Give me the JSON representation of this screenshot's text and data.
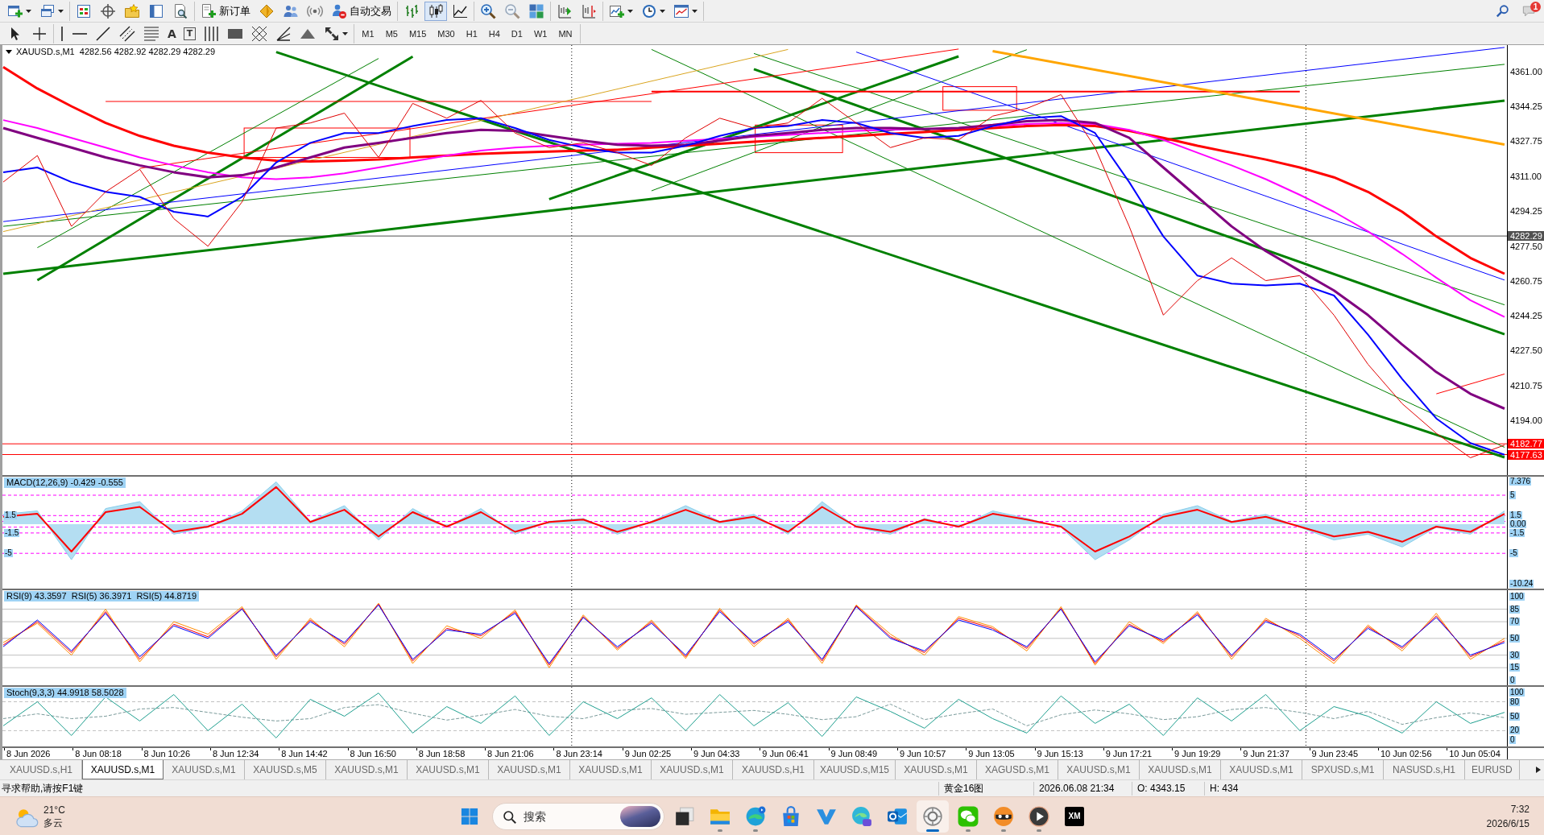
{
  "toolbar": {
    "new_order": "新订单",
    "auto_trading": "自动交易",
    "chart_types": [
      {
        "selected": false
      },
      {
        "selected": true
      },
      {
        "selected": false
      }
    ],
    "notification_count": "1"
  },
  "drawing_toolbar": {
    "text_tool": "A",
    "label_tool": "T",
    "periods": [
      "M1",
      "M5",
      "M15",
      "M30",
      "H1",
      "H4",
      "D1",
      "W1",
      "MN"
    ]
  },
  "chart": {
    "chart_data": {
      "type": "line",
      "title": "XAUUSD.s,M1  4282.56 4282.92 4282.29 4282.29",
      "categories": [
        null,
        null,
        null,
        null,
        null,
        null,
        null,
        null,
        null,
        null,
        null,
        null,
        null,
        null,
        null,
        null,
        null,
        null,
        null,
        null,
        null,
        null,
        null,
        null,
        null,
        null,
        null,
        null,
        null,
        null,
        null,
        null,
        null,
        null,
        null,
        null,
        null,
        null,
        null,
        null,
        null,
        null,
        null,
        null,
        null
      ],
      "ylim": [
        4167.8,
        4373.7
      ],
      "yticks": [
        {
          "value": 4361,
          "label": "4361.00"
        },
        {
          "value": 4344.25,
          "label": "4344.25"
        },
        {
          "value": 4327.75,
          "label": "4327.75"
        },
        {
          "value": 4311,
          "label": "4311.00"
        },
        {
          "value": 4294.25,
          "label": "4294.25"
        },
        {
          "value": 4277.5,
          "label": "4277.50"
        },
        {
          "value": 4260.75,
          "label": "4260.75"
        },
        {
          "value": 4244.25,
          "label": "4244.25"
        },
        {
          "value": 4227.5,
          "label": "4227.50"
        },
        {
          "value": 4210.75,
          "label": "4210.75"
        },
        {
          "value": 4194,
          "label": "4194.00"
        }
      ],
      "series": [
        {
          "color": "#008000",
          "values": [
            4264.2,
            null,
            null,
            null,
            null,
            null,
            null,
            null,
            null,
            null,
            null,
            null,
            null,
            null,
            null,
            null,
            null,
            null,
            null,
            null,
            null,
            null,
            null,
            null,
            null,
            null,
            null,
            null,
            null,
            null,
            null,
            null,
            null,
            null,
            null,
            null,
            null,
            null,
            null,
            null,
            null,
            null,
            null,
            null,
            4347.1
          ]
        },
        {
          "color": "#008000",
          "values": [
            null,
            4261.1,
            null,
            null,
            null,
            null,
            null,
            null,
            null,
            null,
            null,
            null,
            4368.2,
            null,
            null,
            null,
            null,
            null,
            null,
            null,
            null,
            null,
            null,
            null,
            null,
            null,
            null,
            null,
            null,
            null,
            null,
            null,
            null,
            null,
            null,
            null,
            null,
            null,
            null,
            null,
            null,
            null,
            null,
            null,
            null
          ]
        },
        {
          "color": "#008000",
          "values": [
            null,
            null,
            null,
            null,
            null,
            null,
            null,
            null,
            null,
            null,
            null,
            null,
            null,
            null,
            null,
            null,
            4299.9,
            null,
            null,
            null,
            null,
            null,
            null,
            null,
            null,
            null,
            null,
            null,
            4368.3,
            null,
            null,
            null,
            null,
            null,
            null,
            null,
            null,
            null,
            null,
            null,
            null,
            null,
            null,
            null,
            null
          ]
        },
        {
          "color": "#008000",
          "values": [
            null,
            null,
            null,
            null,
            null,
            null,
            null,
            null,
            4370.4,
            null,
            null,
            null,
            null,
            null,
            null,
            null,
            null,
            null,
            null,
            null,
            null,
            null,
            null,
            null,
            null,
            null,
            null,
            null,
            null,
            null,
            null,
            null,
            null,
            null,
            null,
            null,
            null,
            null,
            null,
            null,
            null,
            null,
            null,
            null,
            4176.3
          ]
        },
        {
          "color": "#008000",
          "values": [
            null,
            null,
            null,
            null,
            null,
            null,
            null,
            null,
            null,
            null,
            null,
            null,
            null,
            null,
            null,
            null,
            null,
            null,
            null,
            null,
            null,
            null,
            4362.2,
            null,
            null,
            null,
            null,
            null,
            null,
            null,
            null,
            null,
            null,
            null,
            null,
            null,
            null,
            null,
            null,
            null,
            null,
            null,
            null,
            null,
            4235.2
          ]
        },
        {
          "color": "#008000",
          "values": [
            null,
            4276.7,
            null,
            null,
            null,
            null,
            null,
            null,
            null,
            null,
            null,
            4367.3,
            null,
            null,
            null,
            null,
            null,
            null,
            null,
            null,
            null,
            null,
            null,
            null,
            null,
            null,
            null,
            null,
            null,
            null,
            null,
            null,
            null,
            null,
            null,
            null,
            null,
            null,
            null,
            null,
            null,
            null,
            null,
            null,
            null
          ]
        },
        {
          "color": "#008000",
          "values": [
            null,
            null,
            null,
            null,
            null,
            null,
            null,
            null,
            null,
            null,
            null,
            null,
            null,
            null,
            null,
            null,
            null,
            null,
            null,
            4303.9,
            null,
            null,
            null,
            null,
            null,
            null,
            null,
            null,
            null,
            null,
            4371.5,
            null,
            null,
            null,
            null,
            null,
            null,
            null,
            null,
            null,
            null,
            null,
            null,
            null,
            null
          ]
        },
        {
          "color": "#008000",
          "values": [
            null,
            null,
            null,
            null,
            null,
            null,
            null,
            null,
            null,
            null,
            null,
            null,
            null,
            null,
            null,
            null,
            null,
            null,
            null,
            null,
            null,
            null,
            4369.7,
            null,
            null,
            null,
            null,
            null,
            null,
            null,
            null,
            null,
            null,
            null,
            null,
            null,
            null,
            null,
            null,
            null,
            null,
            null,
            null,
            null,
            4249.3
          ]
        },
        {
          "color": "#008000",
          "values": [
            null,
            null,
            null,
            null,
            null,
            null,
            null,
            null,
            null,
            null,
            null,
            null,
            null,
            null,
            null,
            null,
            null,
            null,
            null,
            4371.6,
            null,
            null,
            null,
            null,
            null,
            null,
            null,
            null,
            null,
            null,
            null,
            null,
            null,
            null,
            null,
            null,
            null,
            null,
            null,
            null,
            null,
            null,
            null,
            null,
            4181.1
          ]
        },
        {
          "color": "#008000",
          "values": [
            4286.9,
            null,
            null,
            null,
            null,
            null,
            null,
            null,
            null,
            null,
            null,
            null,
            null,
            null,
            null,
            null,
            null,
            null,
            null,
            null,
            null,
            null,
            null,
            null,
            null,
            null,
            null,
            null,
            null,
            null,
            null,
            null,
            null,
            null,
            null,
            null,
            null,
            null,
            null,
            null,
            null,
            null,
            null,
            null,
            4364.5
          ]
        },
        {
          "color": "#0000ff",
          "values": [
            4289.2,
            null,
            null,
            null,
            null,
            null,
            null,
            null,
            null,
            null,
            null,
            null,
            null,
            null,
            null,
            null,
            null,
            null,
            null,
            null,
            null,
            null,
            null,
            null,
            null,
            null,
            null,
            null,
            null,
            null,
            null,
            null,
            null,
            null,
            null,
            null,
            null,
            null,
            null,
            null,
            null,
            null,
            null,
            null,
            4372.6
          ]
        },
        {
          "color": "#0000ff",
          "values": [
            null,
            null,
            null,
            null,
            null,
            null,
            null,
            null,
            null,
            null,
            null,
            null,
            null,
            null,
            null,
            null,
            null,
            null,
            null,
            null,
            null,
            null,
            null,
            null,
            null,
            4370.4,
            null,
            null,
            null,
            null,
            null,
            null,
            null,
            null,
            null,
            null,
            null,
            null,
            null,
            null,
            null,
            null,
            null,
            null,
            4261.2
          ]
        },
        {
          "color": "#ff0000",
          "values": [
            null,
            null,
            null,
            4346.7,
            null,
            null,
            null,
            null,
            null,
            null,
            null,
            null,
            null,
            null,
            null,
            null,
            null,
            null,
            null,
            4346.7,
            null,
            null,
            null,
            null,
            null,
            null,
            null,
            null,
            null,
            null,
            null,
            null,
            null,
            null,
            null,
            null,
            null,
            null,
            null,
            null,
            null,
            null,
            null,
            null,
            null
          ]
        },
        {
          "color": "#ff0000",
          "values": [
            null,
            null,
            null,
            null,
            null,
            null,
            null,
            null,
            null,
            null,
            null,
            null,
            null,
            null,
            null,
            null,
            null,
            null,
            null,
            4351.4,
            null,
            null,
            null,
            null,
            null,
            null,
            null,
            null,
            null,
            null,
            null,
            null,
            null,
            null,
            null,
            null,
            null,
            null,
            4351.4,
            null,
            null,
            null,
            null,
            null,
            null
          ]
        },
        {
          "color": "#ff0000",
          "values": [
            null,
            null,
            null,
            null,
            4314.7,
            null,
            null,
            null,
            null,
            null,
            null,
            null,
            null,
            null,
            null,
            null,
            null,
            null,
            null,
            null,
            null,
            null,
            null,
            null,
            null,
            null,
            null,
            null,
            4371.8,
            null,
            null,
            null,
            null,
            null,
            null,
            null,
            null,
            null,
            null,
            null,
            null,
            null,
            null,
            null,
            null
          ]
        },
        {
          "color": "#ff0000",
          "values": [
            null,
            null,
            null,
            null,
            null,
            null,
            null,
            null,
            null,
            null,
            null,
            null,
            null,
            null,
            null,
            null,
            null,
            null,
            null,
            null,
            null,
            null,
            null,
            null,
            null,
            null,
            null,
            null,
            null,
            null,
            null,
            null,
            null,
            null,
            null,
            null,
            null,
            null,
            null,
            null,
            null,
            null,
            4206.7,
            null,
            4216.2
          ]
        },
        {
          "color": "#ffa500",
          "values": [
            null,
            null,
            null,
            null,
            null,
            null,
            null,
            null,
            null,
            null,
            null,
            null,
            null,
            null,
            null,
            null,
            null,
            null,
            null,
            null,
            null,
            null,
            null,
            null,
            null,
            null,
            null,
            null,
            null,
            4370.8,
            null,
            null,
            null,
            null,
            null,
            null,
            null,
            null,
            null,
            null,
            null,
            null,
            null,
            null,
            4326.1
          ]
        },
        {
          "color": "#daa520",
          "values": [
            4284.4,
            null,
            null,
            null,
            null,
            null,
            null,
            null,
            null,
            null,
            null,
            null,
            null,
            null,
            null,
            null,
            null,
            null,
            null,
            null,
            null,
            null,
            null,
            4371.6,
            null,
            null,
            null,
            null,
            null,
            null,
            null,
            null,
            null,
            null,
            null,
            null,
            null,
            null,
            null,
            null,
            null,
            null,
            null,
            null,
            null
          ]
        },
        {
          "color": "#ff0000",
          "values": [
            4363.2,
            4352.9,
            4344.4,
            4336.4,
            4330.2,
            4325.5,
            4322.2,
            4319.9,
            4318.4,
            4318.0,
            4318.4,
            4318.9,
            4319.9,
            4320.8,
            4321.7,
            4322.2,
            4322.7,
            4323.2,
            4323.6,
            4324.6,
            4325.5,
            4326.5,
            4327.4,
            4328.3,
            4329.3,
            4330.2,
            4331.2,
            4332.1,
            4333.1,
            4334.0,
            4334.9,
            4335.4,
            4334.9,
            4332.6,
            4329.3,
            4325.5,
            4322.2,
            4318.9,
            4315.1,
            4310.4,
            4303.4,
            4293.9,
            4282.1,
            4271.8,
            4264.2
          ]
        },
        {
          "color": "#ff00ff",
          "values": [
            4337.8,
            4334.0,
            4329.3,
            4324.6,
            4319.9,
            4316.1,
            4312.8,
            4310.4,
            4309.5,
            4310.4,
            4312.3,
            4315.1,
            4318.0,
            4320.8,
            4323.2,
            4324.6,
            4325.5,
            4326.0,
            4326.5,
            4326.9,
            4327.9,
            4328.8,
            4329.8,
            4330.7,
            4331.6,
            4332.6,
            4333.1,
            4333.5,
            4334.0,
            4334.9,
            4335.9,
            4336.4,
            4335.9,
            4333.1,
            4328.3,
            4322.2,
            4316.1,
            4309.5,
            4302.0,
            4293.9,
            4284.5,
            4273.7,
            4262.3,
            4251.5,
            4243.5
          ]
        },
        {
          "color": "#800080",
          "values": [
            4334.0,
            4329.3,
            4324.6,
            4319.9,
            4316.1,
            4312.8,
            4310.4,
            4311.4,
            4315.1,
            4319.9,
            4324.6,
            4326.9,
            4329.3,
            4331.6,
            4333.1,
            4332.6,
            4330.2,
            4327.9,
            4326.0,
            4325.5,
            4326.0,
            4327.9,
            4330.2,
            4331.6,
            4333.1,
            4334.0,
            4334.0,
            4333.5,
            4334.0,
            4335.4,
            4337.3,
            4337.8,
            4336.4,
            4329.3,
            4315.1,
            4301.0,
            4286.9,
            4275.1,
            4265.6,
            4256.2,
            4244.4,
            4230.3,
            4217.1,
            4206.7,
            4199.6
          ]
        },
        {
          "color": "#0000ff",
          "values": [
            4312.8,
            4315.1,
            4308.1,
            4303.4,
            4301.0,
            4293.9,
            4291.6,
            4301.0,
            4317.5,
            4326.9,
            4331.6,
            4331.6,
            4334.9,
            4337.8,
            4338.7,
            4334.0,
            4328.3,
            4324.6,
            4322.2,
            4322.2,
            4325.5,
            4330.2,
            4334.0,
            4334.9,
            4337.8,
            4336.4,
            4331.6,
            4329.3,
            4330.2,
            4334.9,
            4338.7,
            4339.7,
            4331.6,
            4308.1,
            4282.1,
            4263.3,
            4259.5,
            4258.6,
            4259.5,
            4253.8,
            4235.0,
            4213.8,
            4194.9,
            4183.1,
            4177.5
          ]
        },
        {
          "color": "#e00000",
          "values": [
            4308.1,
            4320.8,
            4286.9,
            4303.4,
            4314.2,
            4290.6,
            4277.4,
            4298.6,
            4334.0,
            4336.4,
            4341.1,
            4319.9,
            4345.8,
            4338.7,
            4347.2,
            4331.6,
            4324.6,
            4326.9,
            4322.2,
            4316.1,
            4329.3,
            4338.7,
            4334.0,
            4336.4,
            4348.2,
            4336.4,
            4324.6,
            4329.3,
            4328.3,
            4339.7,
            4343.4,
            4350.0,
            4324.6,
            4286.9,
            4244.4,
            4260.9,
            4271.8,
            4260.9,
            4263.3,
            4244.4,
            4220.8,
            4202.0,
            4187.8,
            4176.1,
            4182.2
          ]
        }
      ],
      "ref_lines": [
        {
          "axis": "y",
          "value": 4282.29,
          "label": "4282.29",
          "color": "#505050"
        },
        {
          "axis": "y",
          "value": 4182.77,
          "label": "4182.77",
          "color": "#ff0000"
        },
        {
          "axis": "y",
          "value": 4177.63,
          "label": "4177.63",
          "color": "#ff0000"
        }
      ]
    },
    "objects": [
      {
        "kind": "rectangle"
      },
      {
        "kind": "rectangle"
      },
      {
        "kind": "rectangle"
      }
    ],
    "time_labels": [
      "8 Jun 2026",
      "8 Jun 08:18",
      "8 Jun 10:26",
      "8 Jun 12:34",
      "8 Jun 14:42",
      "8 Jun 16:50",
      "8 Jun 18:58",
      "8 Jun 21:06",
      "8 Jun 23:14",
      "9 Jun 02:25",
      "9 Jun 04:33",
      "9 Jun 06:41",
      "9 Jun 08:49",
      "9 Jun 10:57",
      "9 Jun 13:05",
      "9 Jun 15:13",
      "9 Jun 17:21",
      "9 Jun 19:29",
      "9 Jun 21:37",
      "9 Jun 23:45",
      "10 Jun 02:56",
      "10 Jun 05:04"
    ]
  },
  "indicators": [
    {
      "chart_data": {
        "type": "line",
        "title": "MACD(12,26,9) -0.429 -0.555",
        "categories": [
          null,
          null,
          null,
          null,
          null,
          null,
          null,
          null,
          null,
          null,
          null,
          null,
          null,
          null,
          null,
          null,
          null,
          null,
          null,
          null,
          null,
          null,
          null,
          null,
          null,
          null,
          null,
          null,
          null,
          null,
          null,
          null,
          null,
          null,
          null,
          null,
          null,
          null,
          null,
          null,
          null,
          null,
          null,
          null,
          null
        ],
        "ylim": [
          -11.07,
          8.19
        ],
        "yticks": [
          {
            "value": 7.376,
            "label": "7.376"
          },
          {
            "value": 5,
            "label": "5"
          },
          {
            "value": 1.5,
            "label": "1.5"
          },
          {
            "value": 0,
            "label": "0.00"
          },
          {
            "value": -1.5,
            "label": "-1.5"
          },
          {
            "value": -5,
            "label": "-5"
          },
          {
            "value": -10.24,
            "label": "-10.24"
          }
        ],
        "series": [
          {
            "color": "#87ceeb",
            "values": [
              1.7,
              2.3,
              -6.1,
              2.7,
              3.9,
              -1.7,
              -0.5,
              2.3,
              7.3,
              0.5,
              3.2,
              -2.7,
              2.7,
              -0.5,
              2.7,
              -1.7,
              0.5,
              1.0,
              -1.7,
              0.5,
              3.2,
              0.5,
              1.7,
              -1.7,
              3.9,
              -0.5,
              -1.7,
              1.0,
              -0.5,
              2.3,
              1.0,
              -0.5,
              -6.1,
              -2.7,
              1.7,
              3.2,
              0.5,
              1.7,
              -0.5,
              -2.7,
              -1.7,
              -3.9,
              -0.5,
              -1.7,
              2.3
            ]
          },
          {
            "color": "#ff0000",
            "values": [
              1.3,
              1.8,
              -4.7,
              2.1,
              3.0,
              -1.3,
              -0.4,
              1.8,
              6.4,
              0.4,
              2.5,
              -2.1,
              2.1,
              -0.4,
              2.1,
              -1.3,
              0.4,
              0.8,
              -1.3,
              0.4,
              2.5,
              0.4,
              1.3,
              -1.3,
              3.0,
              -0.4,
              -1.3,
              0.8,
              -0.4,
              1.8,
              0.8,
              -0.4,
              -4.7,
              -2.1,
              1.3,
              2.5,
              0.4,
              1.3,
              -0.4,
              -2.1,
              -1.3,
              -3.0,
              -0.4,
              -1.3,
              1.8
            ]
          }
        ],
        "ref_lines": [
          {
            "axis": "y",
            "value": 5,
            "color": "#ff00ff"
          },
          {
            "axis": "y",
            "value": 1.5,
            "color": "#ff00ff",
            "label": "1.5"
          },
          {
            "axis": "y",
            "value": 0.5,
            "color": "#ff00ff"
          },
          {
            "axis": "y",
            "value": -0.5,
            "color": "#ff00ff"
          },
          {
            "axis": "y",
            "value": -1.5,
            "color": "#ff00ff",
            "label": "-1.5"
          },
          {
            "axis": "y",
            "value": -5,
            "color": "#ff00ff",
            "label": "-5"
          }
        ]
      }
    },
    {
      "chart_data": {
        "type": "line",
        "title": "RSI(9) 43.3597  RSI(5) 36.3971  RSI(5) 44.8719",
        "categories": [
          null,
          null,
          null,
          null,
          null,
          null,
          null,
          null,
          null,
          null,
          null,
          null,
          null,
          null,
          null,
          null,
          null,
          null,
          null,
          null,
          null,
          null,
          null,
          null,
          null,
          null,
          null,
          null,
          null,
          null,
          null,
          null,
          null,
          null,
          null,
          null,
          null,
          null,
          null,
          null,
          null,
          null,
          null,
          null,
          null
        ],
        "ylim": [
          -6,
          107.6
        ],
        "yticks": [
          {
            "value": 100,
            "label": "100"
          },
          {
            "value": 85,
            "label": "85"
          },
          {
            "value": 70,
            "label": "70"
          },
          {
            "value": 50,
            "label": "50"
          },
          {
            "value": 30,
            "label": "30"
          },
          {
            "value": 15,
            "label": "15"
          },
          {
            "value": 0,
            "label": "0"
          }
        ],
        "series": [
          {
            "color": "#ff8c00",
            "values": [
              45,
              68,
              30,
              85,
              22,
              70,
              55,
              88,
              25,
              74,
              40,
              92,
              20,
              65,
              50,
              84,
              15,
              78,
              36,
              72,
              26,
              86,
              40,
              74,
              20,
              90,
              55,
              30,
              76,
              64,
              35,
              88,
              18,
              70,
              44,
              82,
              25,
              74,
              50,
              20,
              66,
              35,
              80,
              25,
              50
            ]
          },
          {
            "color": "#ff0000",
            "values": [
              42,
              70,
              33,
              82,
              25,
              67,
              52,
              86,
              28,
              72,
              43,
              91,
              23,
              62,
              53,
              82,
              18,
              76,
              38,
              70,
              28,
              84,
              43,
              72,
              23,
              89,
              52,
              33,
              74,
              62,
              38,
              86,
              20,
              67,
              46,
              80,
              28,
              72,
              53,
              23,
              64,
              38,
              77,
              28,
              47
            ]
          },
          {
            "color": "#0000ff",
            "values": [
              40,
              72,
              35,
              80,
              28,
              65,
              50,
              85,
              30,
              70,
              45,
              90,
              25,
              60,
              55,
              80,
              20,
              75,
              40,
              68,
              30,
              82,
              45,
              70,
              25,
              88,
              50,
              35,
              72,
              60,
              40,
              85,
              22,
              65,
              48,
              78,
              30,
              70,
              55,
              25,
              62,
              40,
              75,
              30,
              45
            ]
          }
        ],
        "ref_lines": [
          {
            "axis": "y",
            "value": 85,
            "color": "#c0c0c0"
          },
          {
            "axis": "y",
            "value": 70,
            "color": "#c0c0c0"
          },
          {
            "axis": "y",
            "value": 50,
            "color": "#c0c0c0"
          },
          {
            "axis": "y",
            "value": 30,
            "color": "#c0c0c0"
          },
          {
            "axis": "y",
            "value": 15,
            "color": "#c0c0c0"
          }
        ]
      }
    },
    {
      "chart_data": {
        "type": "line",
        "title": "Stoch(9,3,3) 44.9918 58.5028",
        "categories": [
          null,
          null,
          null,
          null,
          null,
          null,
          null,
          null,
          null,
          null,
          null,
          null,
          null,
          null,
          null,
          null,
          null,
          null,
          null,
          null,
          null,
          null,
          null,
          null,
          null,
          null,
          null,
          null,
          null,
          null,
          null,
          null,
          null,
          null,
          null,
          null,
          null,
          null,
          null,
          null,
          null,
          null,
          null,
          null,
          null
        ],
        "ylim": [
          -12.7,
          110.9
        ],
        "yticks": [
          {
            "value": 100,
            "label": "100"
          },
          {
            "value": 80,
            "label": "80"
          },
          {
            "value": 50,
            "label": "50"
          },
          {
            "value": 20,
            "label": "20"
          },
          {
            "value": 0,
            "label": "0"
          }
        ],
        "series": [
          {
            "color": "#7a9a9a",
            "line_style": "dashed",
            "values": [
              45,
              55,
              45,
              50,
              65,
              68,
              58,
              48,
              40,
              45,
              68,
              74,
              56,
              42,
              52,
              64,
              50,
              45,
              62,
              66,
              54,
              58,
              62,
              54,
              43,
              49,
              75,
              43,
              55,
              65,
              30,
              53,
              63,
              55,
              43,
              49,
              64,
              68,
              58,
              45,
              60,
              33,
              47,
              57,
              47
            ]
          },
          {
            "color": "#20a090",
            "values": [
              30,
              80,
              10,
              90,
              40,
              95,
              20,
              75,
              5,
              85,
              50,
              98,
              15,
              70,
              35,
              92,
              10,
              80,
              45,
              88,
              20,
              95,
              30,
              78,
              8,
              90,
              60,
              25,
              85,
              45,
              15,
              92,
              35,
              75,
              10,
              88,
              40,
              95,
              20,
              70,
              50,
              15,
              80,
              35,
              58
            ]
          }
        ],
        "ref_lines": [
          {
            "axis": "y",
            "value": 80,
            "color": "#c0c0c0"
          },
          {
            "axis": "y",
            "value": 20,
            "color": "#c0c0c0"
          }
        ]
      }
    }
  ],
  "tabs": [
    {
      "label": "XAUUSD.s,H1",
      "selected": false
    },
    {
      "label": "XAUUSD.s,M1",
      "selected": true
    },
    {
      "label": "XAUUSD.s,M1",
      "selected": false
    },
    {
      "label": "XAUUSD.s,M5",
      "selected": false
    },
    {
      "label": "XAUUSD.s,M1",
      "selected": false
    },
    {
      "label": "XAUUSD.s,M1",
      "selected": false
    },
    {
      "label": "XAUUSD.s,M1",
      "selected": false
    },
    {
      "label": "XAUUSD.s,M1",
      "selected": false
    },
    {
      "label": "XAUUSD.s,M1",
      "selected": false
    },
    {
      "label": "XAUUSD.s,H1",
      "selected": false
    },
    {
      "label": "XAUUSD.s,M15",
      "selected": false
    },
    {
      "label": "XAUUSD.s,M1",
      "selected": false
    },
    {
      "label": "XAGUSD.s,M1",
      "selected": false
    },
    {
      "label": "XAUUSD.s,M1",
      "selected": false
    },
    {
      "label": "XAUUSD.s,M1",
      "selected": false
    },
    {
      "label": "XAUUSD.s,M1",
      "selected": false
    },
    {
      "label": "SPXUSD.s,M1",
      "selected": false
    },
    {
      "label": "NASUSD.s,H1",
      "selected": false
    },
    {
      "label": "EURUSD",
      "selected": false
    }
  ],
  "status_bar": {
    "help": "寻求帮助,请按F1键",
    "fields": [
      "黄金16图",
      "2026.06.08 21:34",
      "O: 4343.15",
      "H: 434"
    ]
  },
  "taskbar": {
    "weather": {
      "temperature": "21°C",
      "condition": "多云"
    },
    "search": {
      "placeholder": "搜索"
    },
    "apps": [
      {
        "kind": "task-view",
        "running": false,
        "active": false
      },
      {
        "kind": "folder",
        "running": true,
        "active": false
      },
      {
        "kind": "browser",
        "running": true,
        "active": false
      },
      {
        "kind": "store",
        "running": false,
        "active": false
      },
      {
        "kind": "v-logo",
        "running": false,
        "active": false
      },
      {
        "kind": "browser-ai",
        "running": false,
        "active": false
      },
      {
        "kind": "mail",
        "running": false,
        "active": false
      },
      {
        "kind": "ring",
        "running": true,
        "active": true
      },
      {
        "kind": "chat",
        "running": true,
        "active": false
      },
      {
        "kind": "mascot",
        "running": true,
        "active": false
      },
      {
        "kind": "player",
        "running": true,
        "active": false
      },
      {
        "kind": "logo",
        "running": false,
        "active": false,
        "label": "XM"
      }
    ],
    "clock": {
      "time": "7:32",
      "date": "2026/6/15"
    }
  }
}
